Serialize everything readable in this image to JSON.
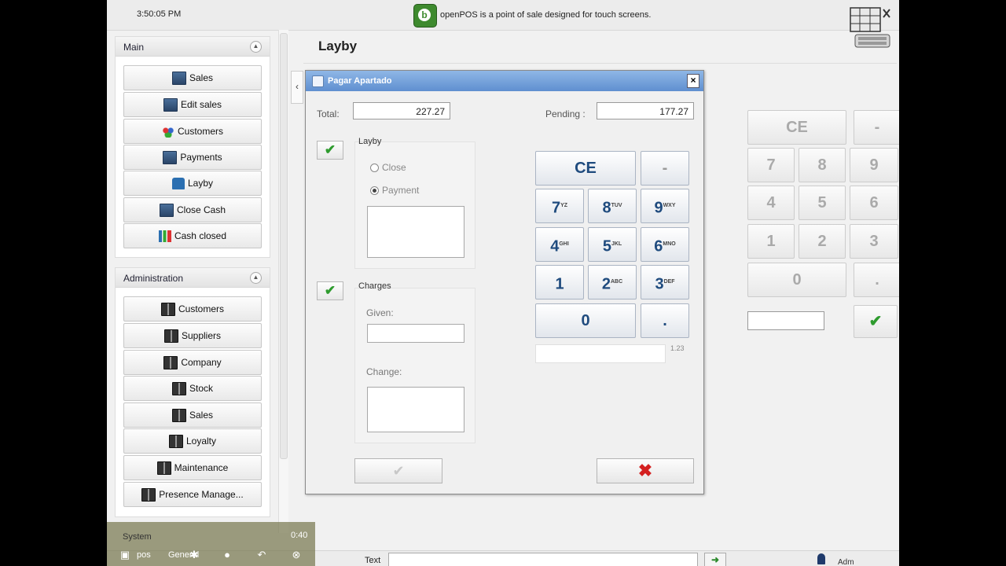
{
  "topbar": {
    "clock": "3:50:05 PM",
    "tagline": "openPOS is a point of sale designed for touch screens.",
    "logo_letter": "b"
  },
  "sidebar": {
    "main_title": "Main",
    "main_items": [
      {
        "label": "Sales",
        "icon": "monitor-icon"
      },
      {
        "label": "Edit sales",
        "icon": "monitor-icon"
      },
      {
        "label": "Customers",
        "icon": "people-icon"
      },
      {
        "label": "Payments",
        "icon": "monitor-icon"
      },
      {
        "label": "Layby",
        "icon": "house-icon"
      },
      {
        "label": "Close Cash",
        "icon": "monitor-icon"
      },
      {
        "label": "Cash closed",
        "icon": "chart-icon"
      }
    ],
    "admin_title": "Administration",
    "admin_items": [
      {
        "label": "Customers",
        "icon": "book-icon"
      },
      {
        "label": "Suppliers",
        "icon": "book-icon"
      },
      {
        "label": "Company",
        "icon": "book-icon"
      },
      {
        "label": "Stock",
        "icon": "book-icon"
      },
      {
        "label": "Sales",
        "icon": "book-icon"
      },
      {
        "label": "Loyalty",
        "icon": "book-icon"
      },
      {
        "label": "Maintenance",
        "icon": "book-icon"
      },
      {
        "label": "Presence Manage...",
        "icon": "book-icon"
      }
    ],
    "system_title": "System"
  },
  "main": {
    "title": "Layby"
  },
  "bg_keypad": {
    "ce": "CE",
    "minus": "-",
    "digits": [
      "7",
      "8",
      "9",
      "4",
      "5",
      "6",
      "1",
      "2",
      "3"
    ],
    "zero": "0",
    "dot": "."
  },
  "dialog": {
    "title": "Pagar Apartado",
    "total_label": "Total:",
    "total_value": "227.27",
    "pending_label": "Pending :",
    "pending_value": "177.27",
    "layby_group": "Layby",
    "radio_close": "Close",
    "radio_payment": "Payment",
    "charges_group": "Charges",
    "given_label": "Given:",
    "change_label": "Change:",
    "keypad": {
      "ce": "CE",
      "minus": "-",
      "zero": "0",
      "dot": ".",
      "keys": [
        {
          "d": "7",
          "s": "YZ"
        },
        {
          "d": "8",
          "s": "TUV"
        },
        {
          "d": "9",
          "s": "WXY"
        },
        {
          "d": "4",
          "s": "GHI"
        },
        {
          "d": "5",
          "s": "JKL"
        },
        {
          "d": "6",
          "s": "MNO"
        },
        {
          "d": "1",
          "s": ""
        },
        {
          "d": "2",
          "s": "ABC"
        },
        {
          "d": "3",
          "s": "DEF"
        }
      ]
    },
    "keypad_hint": "1.23"
  },
  "bottom": {
    "text_label": "Text",
    "user_label": "Adm"
  },
  "video": {
    "time": "0:40",
    "tab1": "pos",
    "tab2": "General"
  },
  "colors": {
    "accent": "#1f4b7e",
    "title_bar": "#6f9bd8",
    "confirm": "#2e9b2e",
    "cancel": "#d42020"
  }
}
